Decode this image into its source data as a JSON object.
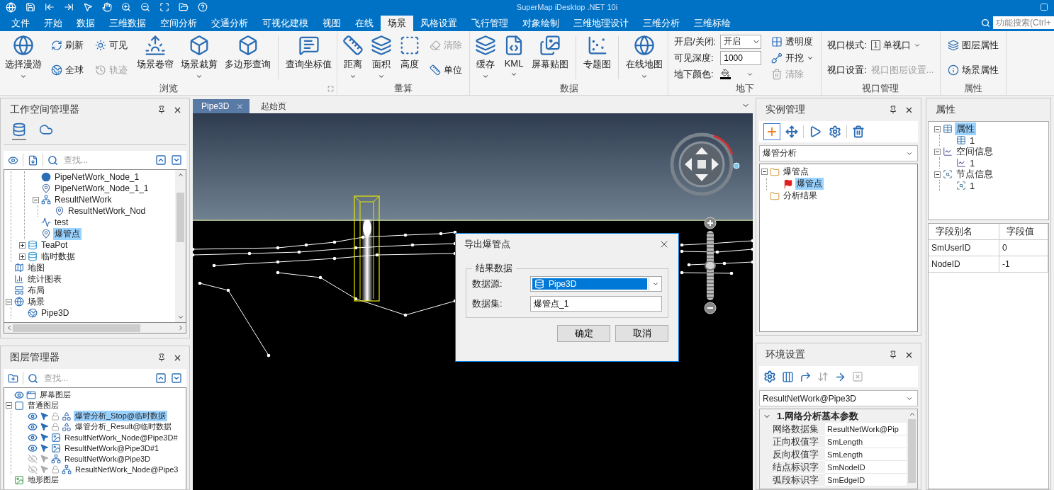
{
  "window": {
    "title": "SuperMap iDesktop .NET 10i"
  },
  "menu_tabs": [
    {
      "label": "文件",
      "selected": false
    },
    {
      "label": "开始",
      "selected": false
    },
    {
      "label": "数据",
      "selected": false
    },
    {
      "label": "三维数据",
      "selected": false
    },
    {
      "label": "空间分析",
      "selected": false
    },
    {
      "label": "交通分析",
      "selected": false
    },
    {
      "label": "可视化建模",
      "selected": false
    },
    {
      "label": "视图",
      "selected": false
    },
    {
      "label": "在线",
      "selected": false
    },
    {
      "label": "场景",
      "selected": true
    },
    {
      "label": "风格设置",
      "selected": false
    },
    {
      "label": "飞行管理",
      "selected": false
    },
    {
      "label": "对象绘制",
      "selected": false
    },
    {
      "label": "三维地理设计",
      "selected": false
    },
    {
      "label": "三维分析",
      "selected": false
    },
    {
      "label": "三维标绘",
      "selected": false
    }
  ],
  "feature_search": {
    "placeholder": "功能搜索(Ctrl+"
  },
  "ribbon_groups": [
    {
      "title": "浏览",
      "launcher": true,
      "columns": [
        {
          "kind": "large",
          "label": "选择漫游",
          "dropdown": true,
          "disabled": false
        },
        {
          "kind": "stack",
          "items": [
            {
              "label": "刷新",
              "dropdown": false,
              "disabled": false
            },
            {
              "label": "全球",
              "dropdown": false,
              "disabled": false
            }
          ]
        },
        {
          "kind": "stack",
          "items": [
            {
              "label": "可见",
              "dropdown": false,
              "disabled": false
            },
            {
              "label": "轨迹",
              "dropdown": false,
              "disabled": true
            }
          ]
        },
        {
          "kind": "large",
          "label": "场景卷帘",
          "dropdown": false,
          "disabled": false
        },
        {
          "kind": "large",
          "label": "场景裁剪",
          "dropdown": true,
          "disabled": false
        },
        {
          "kind": "large",
          "label": "多边形查询",
          "dropdown": false,
          "disabled": false
        },
        {
          "kind": "separator"
        },
        {
          "kind": "large",
          "label": "查询坐标值",
          "dropdown": false,
          "disabled": false
        }
      ]
    },
    {
      "title": "量算",
      "launcher": false,
      "columns": [
        {
          "kind": "large",
          "label": "距离",
          "dropdown": true,
          "disabled": false
        },
        {
          "kind": "large",
          "label": "面积",
          "dropdown": true,
          "disabled": false
        },
        {
          "kind": "large",
          "label": "高度",
          "dropdown": false,
          "disabled": false
        },
        {
          "kind": "stack",
          "items": [
            {
              "label": "清除",
              "dropdown": false,
              "disabled": true
            },
            {
              "label": "单位",
              "dropdown": false,
              "disabled": false
            }
          ]
        }
      ]
    },
    {
      "title": "数据",
      "launcher": false,
      "columns": [
        {
          "kind": "large",
          "label": "缓存",
          "dropdown": true,
          "disabled": false
        },
        {
          "kind": "large",
          "label": "KML",
          "dropdown": true,
          "disabled": false
        },
        {
          "kind": "large",
          "label": "屏幕贴图",
          "dropdown": false,
          "disabled": false
        },
        {
          "kind": "separator"
        },
        {
          "kind": "large",
          "label": "专题图",
          "dropdown": false,
          "disabled": false
        },
        {
          "kind": "separator"
        },
        {
          "kind": "large",
          "label": "在线地图",
          "dropdown": true,
          "disabled": false
        }
      ]
    },
    {
      "title": "地下",
      "launcher": false,
      "columns": [
        {
          "kind": "form",
          "rows": [
            {
              "label": "开启/关闭:",
              "control": {
                "kind": "select",
                "value": "开启"
              }
            },
            {
              "label": "可见深度:",
              "control": {
                "kind": "input",
                "value": "1000"
              }
            },
            {
              "label": "地下颜色:",
              "control": {
                "kind": "color"
              }
            }
          ]
        },
        {
          "kind": "stack",
          "items": [
            {
              "label": "透明度",
              "dropdown": false,
              "disabled": false
            },
            {
              "label": "开挖",
              "dropdown": true,
              "disabled": false
            },
            {
              "label": "清除",
              "dropdown": false,
              "disabled": true
            }
          ]
        }
      ]
    },
    {
      "title": "视口管理",
      "launcher": false,
      "columns": [
        {
          "kind": "form",
          "rows": [
            {
              "label": "视口模式:",
              "control": {
                "kind": "mode",
                "badge": "1",
                "value": "单视口"
              }
            },
            {
              "label": "视口设置:",
              "control": {
                "kind": "link",
                "value": "视口图层设置...",
                "disabled": true
              }
            }
          ]
        }
      ]
    },
    {
      "title": "属性",
      "launcher": false,
      "columns": [
        {
          "kind": "stack",
          "items": [
            {
              "label": "图层属性",
              "dropdown": false,
              "disabled": false
            },
            {
              "label": "场景属性",
              "dropdown": false,
              "disabled": false
            }
          ]
        }
      ]
    }
  ],
  "workspace_manager": {
    "title": "工作空间管理器",
    "view_tabs": [
      {
        "selected": true
      },
      {
        "selected": false
      }
    ],
    "search": {
      "placeholder": "查找..."
    },
    "tree": [
      {
        "children": [
          {
            "children": [
              {
                "label": "PipeNetWork_Node_1",
                "kind": "point",
                "selected": false
              },
              {
                "label": "PipeNetWork_Node_1_1",
                "kind": "region",
                "selected": false
              },
              {
                "label": "ResultNetWork",
                "kind": "network",
                "expanded": true,
                "selected": false,
                "children": [
                  {
                    "label": "ResultNetWork_Nod",
                    "kind": "region",
                    "selected": false
                  }
                ]
              },
              {
                "label": "test",
                "kind": "line",
                "selected": false
              },
              {
                "label": "爆管点",
                "kind": "region",
                "selected": true
              }
            ]
          },
          {
            "label": "TeaPot",
            "kind": "datasource",
            "expanded": false,
            "selected": false
          },
          {
            "label": "临时数据",
            "kind": "datasource",
            "expanded": false,
            "selected": false
          }
        ]
      },
      {
        "label": "地图",
        "kind": "map",
        "selected": false
      },
      {
        "label": "统计图表",
        "kind": "chart",
        "selected": false
      },
      {
        "label": "布局",
        "kind": "layout",
        "selected": false
      },
      {
        "label": "场景",
        "kind": "scene",
        "expanded": true,
        "selected": false,
        "children": [
          {
            "label": "Pipe3D",
            "kind": "globe",
            "selected": false
          }
        ]
      }
    ]
  },
  "layer_manager": {
    "title": "图层管理器",
    "search": {
      "placeholder": "查找..."
    },
    "tree": [
      {
        "label": "屏幕图层",
        "kind": "screen",
        "visible": true
      },
      {
        "label": "普通图层",
        "kind": "group",
        "expanded": true,
        "children": [
          {
            "label": "爆管分析_Stop@临时数据",
            "kind": "cad",
            "visible": true,
            "selectable": true,
            "locked": true,
            "selected": true
          },
          {
            "label": "爆管分析_Result@临时数据",
            "kind": "cad",
            "visible": true,
            "selectable": true,
            "locked": true,
            "selected": false
          },
          {
            "label": "ResultNetWork_Node@Pipe3D#",
            "kind": "image",
            "visible": true,
            "selectable": true,
            "locked": false,
            "selected": false
          },
          {
            "label": "ResultNetWork@Pipe3D#1",
            "kind": "image",
            "visible": true,
            "selectable": true,
            "locked": false,
            "selected": false
          },
          {
            "label": "ResultNetWork@Pipe3D",
            "kind": "network",
            "visible": false,
            "selectable": false,
            "locked": false,
            "selected": false
          },
          {
            "label": "ResultNetWork_Node@Pipe3",
            "kind": "network",
            "visible": false,
            "selectable": false,
            "locked": true,
            "selected": false
          }
        ]
      },
      {
        "label": "地形图层",
        "kind": "terrain"
      }
    ]
  },
  "document_tabs": [
    {
      "label": "Pipe3D",
      "selected": true
    },
    {
      "label": "起始页",
      "selected": false
    }
  ],
  "scene": {
    "zoom_slider": {
      "level": 0.5
    }
  },
  "dialog": {
    "title": "导出爆管点",
    "group": "结果数据",
    "fields": [
      {
        "label": "数据源:",
        "kind": "select",
        "value": "Pipe3D"
      },
      {
        "label": "数据集:",
        "kind": "input",
        "value": "爆管点_1"
      }
    ],
    "buttons": [
      "确定",
      "取消"
    ]
  },
  "instance_manager": {
    "title": "实例管理",
    "tools": [
      {
        "selected": true
      },
      {
        "selected": false
      },
      {
        "selected": false
      },
      {
        "selected": false
      },
      {
        "selected": false
      }
    ],
    "scheme": {
      "value": "爆管分析"
    },
    "tree": [
      {
        "label": "爆管点",
        "kind": "folder",
        "expanded": true,
        "selected": false,
        "children": [
          {
            "label": "爆管点",
            "kind": "flag",
            "selected": true
          }
        ]
      },
      {
        "label": "分析结果",
        "kind": "folder",
        "selected": false
      }
    ]
  },
  "environment": {
    "title": "环境设置",
    "dataset": {
      "value": "ResultNetWork@Pipe3D"
    },
    "categories": [
      {
        "title": "1.网络分析基本参数",
        "expanded": true,
        "rows": [
          {
            "name": "网络数据集",
            "value": "ResultNetWork@Pip"
          },
          {
            "name": "正向权值字",
            "value": "SmLength"
          },
          {
            "name": "反向权值字",
            "value": "SmLength"
          },
          {
            "name": "结点标识字",
            "value": "SmNodeID"
          },
          {
            "name": "弧段标识字",
            "value": "SmEdgeID"
          }
        ]
      }
    ]
  },
  "properties": {
    "title": "属性",
    "tree": [
      {
        "label": "属性",
        "kind": "table",
        "expanded": true,
        "selected": true,
        "children": [
          {
            "label": "1",
            "kind": "table",
            "selected": false
          }
        ]
      },
      {
        "label": "空间信息",
        "kind": "spatial",
        "expanded": true,
        "selected": false,
        "children": [
          {
            "label": "1",
            "kind": "spatial",
            "selected": false
          }
        ]
      },
      {
        "label": "节点信息",
        "kind": "node",
        "expanded": true,
        "selected": false,
        "children": [
          {
            "label": "1",
            "kind": "node",
            "selected": false
          }
        ]
      }
    ],
    "table": {
      "columns": [
        "字段别名",
        "字段值"
      ],
      "rows": [
        [
          "SmUserID",
          "0"
        ],
        [
          "NodeID",
          "-1"
        ]
      ]
    }
  }
}
